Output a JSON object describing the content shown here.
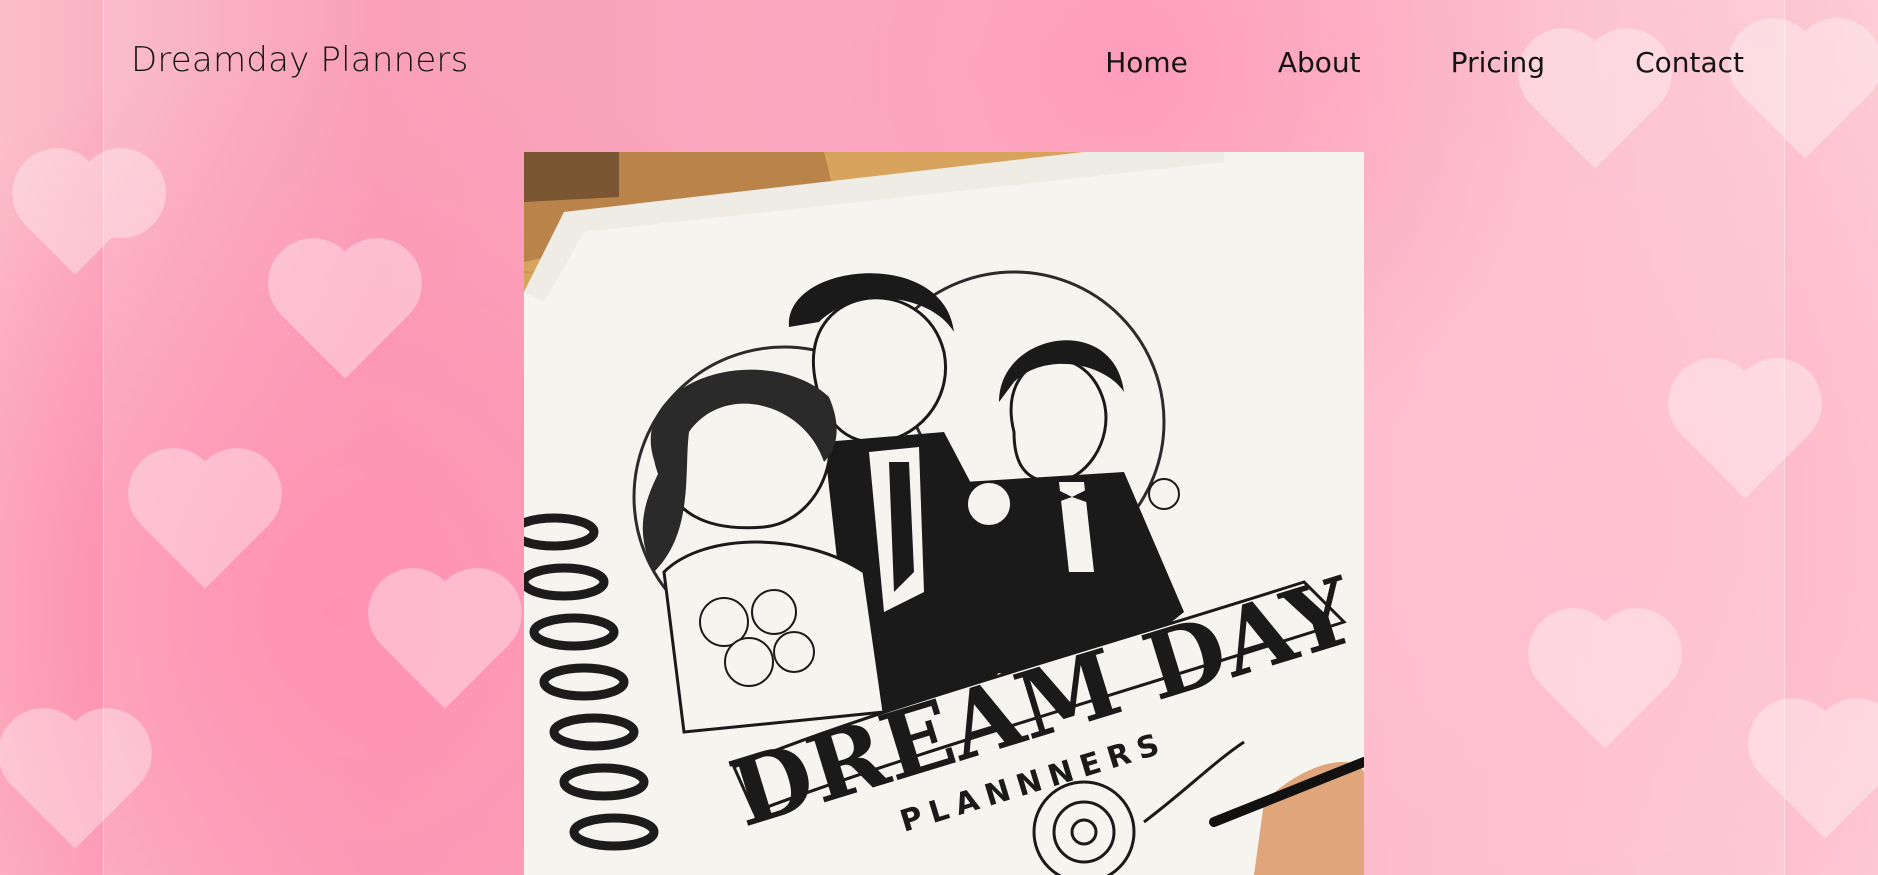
{
  "header": {
    "brand": "Dreamday Planners"
  },
  "nav": {
    "items": [
      {
        "label": "Home"
      },
      {
        "label": "About"
      },
      {
        "label": "Pricing"
      },
      {
        "label": "Contact"
      }
    ]
  },
  "hero": {
    "logo_title": "DREAM DAY",
    "logo_subtitle": "PLANNNERS"
  },
  "colors": {
    "background": "#f990ad",
    "text": "#141414"
  }
}
